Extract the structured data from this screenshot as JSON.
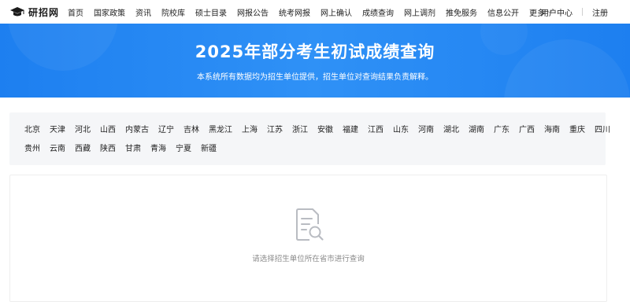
{
  "site": {
    "logo_text": "研招网"
  },
  "nav": {
    "links": [
      "首页",
      "国家政策",
      "资讯",
      "院校库",
      "硕士目录",
      "网报公告",
      "统考网报",
      "网上确认",
      "成绩查询",
      "网上调剂",
      "推免服务",
      "信息公开"
    ],
    "more_label": "更多",
    "user_center": "用户中心",
    "register": "注册"
  },
  "banner": {
    "title": "2025年部分考生初试成绩查询",
    "subtitle": "本系统所有数据均为招生单位提供，招生单位对查询结果负责解释。"
  },
  "provinces": {
    "row1": [
      "北京",
      "天津",
      "河北",
      "山西",
      "内蒙古",
      "辽宁",
      "吉林",
      "黑龙江",
      "上海",
      "江苏",
      "浙江",
      "安徽",
      "福建",
      "江西",
      "山东",
      "河南",
      "湖北",
      "湖南",
      "广东",
      "广西",
      "海南",
      "重庆",
      "四川"
    ],
    "row2": [
      "贵州",
      "云南",
      "西藏",
      "陕西",
      "甘肃",
      "青海",
      "宁夏",
      "新疆"
    ]
  },
  "result": {
    "empty_icon": "document-search-icon",
    "empty_text": "请选择招生单位所在省市进行查询"
  },
  "colors": {
    "banner_blue": "#1d7ff0",
    "panel_bg": "#f5f6f8",
    "icon_gray": "#b9bcc2"
  }
}
